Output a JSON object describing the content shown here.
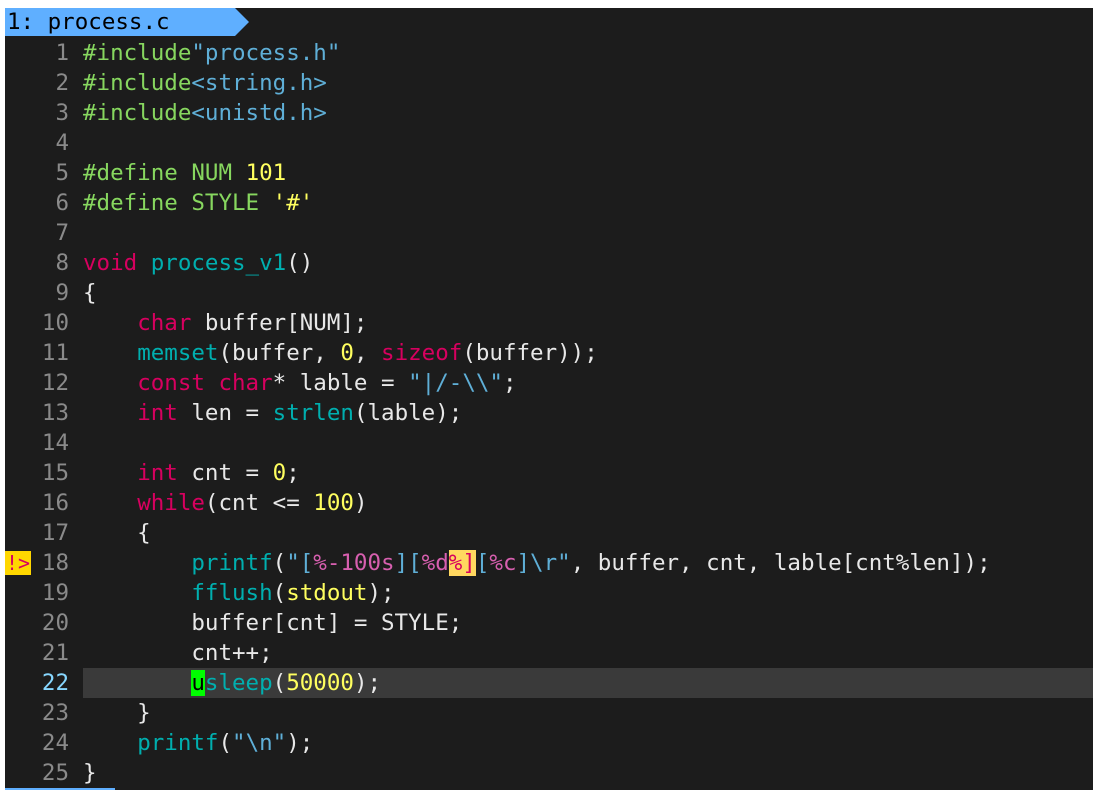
{
  "tab": {
    "index": "1:",
    "filename": "process.c"
  },
  "colors": {
    "background": "#1c1c1c",
    "tab_bg": "#5fafff",
    "preproc": "#87d75f",
    "string": "#5fafd7",
    "keyword": "#d7005f",
    "function": "#00afaf",
    "number": "#ffff5f",
    "cursor": "#00ff00",
    "current_line": "#3a3a3a",
    "line_number": "#8a8a8a",
    "current_line_number": "#87d7ff"
  },
  "sign": {
    "line": 18,
    "text": "!>"
  },
  "cursor": {
    "line": 22,
    "column": 9
  },
  "lines": [
    {
      "n": "1",
      "tokens": [
        [
          "k-pre",
          "#include"
        ],
        [
          "k-str",
          "\"process.h\""
        ]
      ]
    },
    {
      "n": "2",
      "tokens": [
        [
          "k-pre",
          "#include"
        ],
        [
          "k-str",
          "<string.h>"
        ]
      ]
    },
    {
      "n": "3",
      "tokens": [
        [
          "k-pre",
          "#include"
        ],
        [
          "k-str",
          "<unistd.h>"
        ]
      ]
    },
    {
      "n": "4",
      "tokens": []
    },
    {
      "n": "5",
      "tokens": [
        [
          "k-pre",
          "#define NUM "
        ],
        [
          "k-num",
          "101"
        ]
      ]
    },
    {
      "n": "6",
      "tokens": [
        [
          "k-pre",
          "#define STYLE "
        ],
        [
          "k-num",
          "'#'"
        ]
      ]
    },
    {
      "n": "7",
      "tokens": []
    },
    {
      "n": "8",
      "tokens": [
        [
          "k-type",
          "void"
        ],
        [
          "k-plain",
          " "
        ],
        [
          "k-func",
          "process_v1"
        ],
        [
          "k-plain",
          "()"
        ]
      ]
    },
    {
      "n": "9",
      "tokens": [
        [
          "k-plain",
          "{"
        ]
      ]
    },
    {
      "n": "10",
      "tokens": [
        [
          "k-plain",
          "    "
        ],
        [
          "k-type",
          "char"
        ],
        [
          "k-plain",
          " buffer[NUM];"
        ]
      ]
    },
    {
      "n": "11",
      "tokens": [
        [
          "k-plain",
          "    "
        ],
        [
          "k-func",
          "memset"
        ],
        [
          "k-plain",
          "(buffer, "
        ],
        [
          "k-num",
          "0"
        ],
        [
          "k-plain",
          ", "
        ],
        [
          "k-type",
          "sizeof"
        ],
        [
          "k-plain",
          "(buffer));"
        ]
      ]
    },
    {
      "n": "12",
      "tokens": [
        [
          "k-plain",
          "    "
        ],
        [
          "k-type",
          "const"
        ],
        [
          "k-plain",
          " "
        ],
        [
          "k-type",
          "char"
        ],
        [
          "k-plain",
          "* lable = "
        ],
        [
          "k-str",
          "\"|/-"
        ],
        [
          "k-esc",
          "\\\\"
        ],
        [
          "k-str",
          "\""
        ],
        [
          "k-plain",
          ";"
        ]
      ]
    },
    {
      "n": "13",
      "tokens": [
        [
          "k-plain",
          "    "
        ],
        [
          "k-type",
          "int"
        ],
        [
          "k-plain",
          " len = "
        ],
        [
          "k-func",
          "strlen"
        ],
        [
          "k-plain",
          "(lable);"
        ]
      ]
    },
    {
      "n": "14",
      "tokens": []
    },
    {
      "n": "15",
      "tokens": [
        [
          "k-plain",
          "    "
        ],
        [
          "k-type",
          "int"
        ],
        [
          "k-plain",
          " cnt = "
        ],
        [
          "k-num",
          "0"
        ],
        [
          "k-plain",
          ";"
        ]
      ]
    },
    {
      "n": "16",
      "tokens": [
        [
          "k-plain",
          "    "
        ],
        [
          "k-type",
          "while"
        ],
        [
          "k-plain",
          "(cnt <= "
        ],
        [
          "k-num",
          "100"
        ],
        [
          "k-plain",
          ")"
        ]
      ]
    },
    {
      "n": "17",
      "tokens": [
        [
          "k-plain",
          "    {"
        ]
      ]
    },
    {
      "n": "18",
      "tokens": [
        [
          "k-plain",
          "        "
        ],
        [
          "k-func",
          "printf"
        ],
        [
          "k-plain",
          "("
        ],
        [
          "k-str",
          "\"["
        ],
        [
          "k-fmt",
          "%-100s"
        ],
        [
          "k-str",
          "]["
        ],
        [
          "k-fmt",
          "%d"
        ],
        [
          "hl-yellow",
          "%]"
        ],
        [
          "k-str",
          "["
        ],
        [
          "k-fmt",
          "%c"
        ],
        [
          "k-str",
          "]"
        ],
        [
          "k-esc",
          "\\r"
        ],
        [
          "k-str",
          "\""
        ],
        [
          "k-plain",
          ", buffer, cnt, lable[cnt%len]);"
        ]
      ]
    },
    {
      "n": "19",
      "tokens": [
        [
          "k-plain",
          "        "
        ],
        [
          "k-func",
          "fflush"
        ],
        [
          "k-plain",
          "("
        ],
        [
          "k-num",
          "stdout"
        ],
        [
          "k-plain",
          ");"
        ]
      ]
    },
    {
      "n": "20",
      "tokens": [
        [
          "k-plain",
          "        buffer[cnt] = STYLE;"
        ]
      ]
    },
    {
      "n": "21",
      "tokens": [
        [
          "k-plain",
          "        cnt++;"
        ]
      ]
    },
    {
      "n": "22",
      "tokens": [
        [
          "k-plain",
          "        "
        ],
        [
          "cursor",
          "u"
        ],
        [
          "k-func",
          "sleep"
        ],
        [
          "k-plain",
          "("
        ],
        [
          "k-num",
          "50000"
        ],
        [
          "k-plain",
          ");"
        ]
      ]
    },
    {
      "n": "23",
      "tokens": [
        [
          "k-plain",
          "    }"
        ]
      ]
    },
    {
      "n": "24",
      "tokens": [
        [
          "k-plain",
          "    "
        ],
        [
          "k-func",
          "printf"
        ],
        [
          "k-plain",
          "("
        ],
        [
          "k-str",
          "\""
        ],
        [
          "k-esc",
          "\\n"
        ],
        [
          "k-str",
          "\""
        ],
        [
          "k-plain",
          ");"
        ]
      ]
    },
    {
      "n": "25",
      "tokens": [
        [
          "k-plain",
          "}"
        ]
      ]
    }
  ]
}
